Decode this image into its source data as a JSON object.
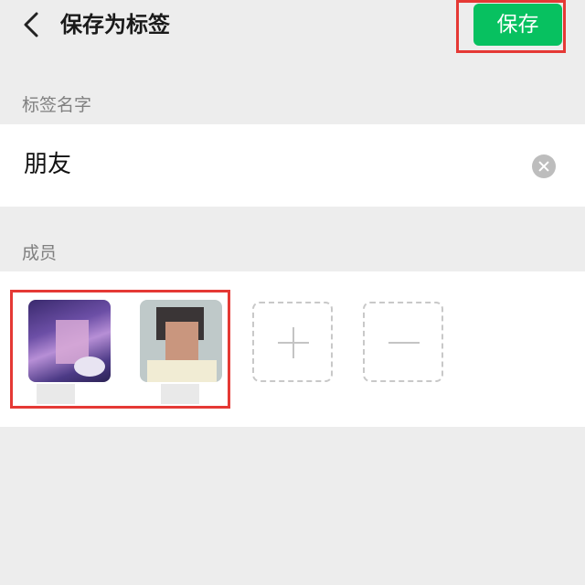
{
  "header": {
    "title": "保存为标签",
    "save_label": "保存"
  },
  "tag_section": {
    "label": "标签名字",
    "value": "朋友"
  },
  "members_section": {
    "label": "成员",
    "members": [
      {
        "avatar": "avatar-1"
      },
      {
        "avatar": "avatar-2"
      }
    ]
  },
  "colors": {
    "accent": "#07c160",
    "highlight": "#e53935",
    "background": "#ededed"
  },
  "icons": [
    "back-chevron-icon",
    "clear-icon",
    "plus-icon",
    "minus-icon"
  ]
}
